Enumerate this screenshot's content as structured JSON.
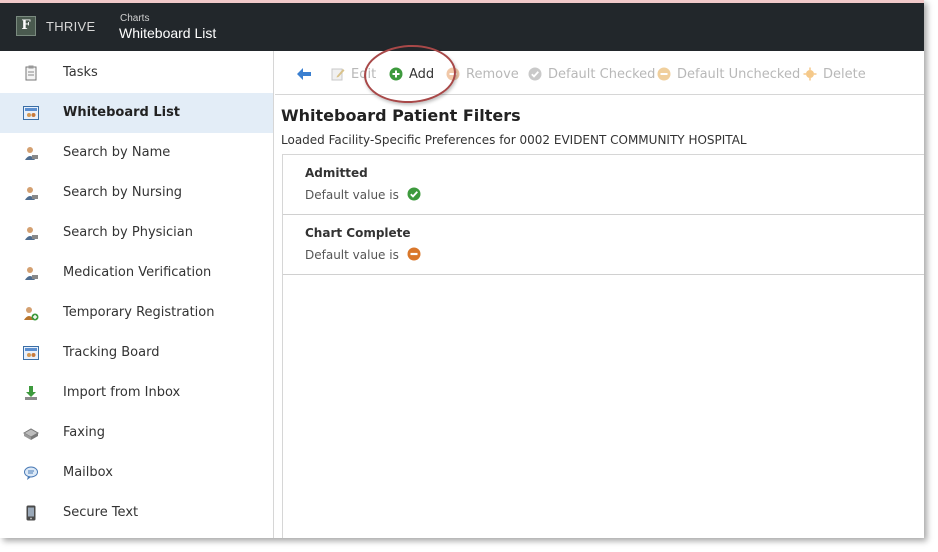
{
  "header": {
    "brand": "THRIVE",
    "section": "Charts",
    "title": "Whiteboard List"
  },
  "sidebar": {
    "items": [
      {
        "label": "Tasks",
        "icon": "clipboard-icon"
      },
      {
        "label": "Whiteboard List",
        "icon": "whiteboard-icon",
        "active": true
      },
      {
        "label": "Search by Name",
        "icon": "person-search-icon"
      },
      {
        "label": "Search by Nursing",
        "icon": "person-search-icon"
      },
      {
        "label": "Search by Physician",
        "icon": "person-search-icon"
      },
      {
        "label": "Medication Verification",
        "icon": "person-search-icon"
      },
      {
        "label": "Temporary Registration",
        "icon": "person-add-icon"
      },
      {
        "label": "Tracking Board",
        "icon": "whiteboard-icon"
      },
      {
        "label": "Import from Inbox",
        "icon": "import-icon"
      },
      {
        "label": "Faxing",
        "icon": "fax-icon"
      },
      {
        "label": "Mailbox",
        "icon": "mailbox-icon"
      },
      {
        "label": "Secure Text",
        "icon": "phone-icon"
      }
    ]
  },
  "toolbar": {
    "edit_label": "Edit",
    "add_label": "Add",
    "remove_label": "Remove",
    "default_checked_label": "Default Checked",
    "default_unchecked_label": "Default Unchecked",
    "delete_label": "Delete"
  },
  "main": {
    "title": "Whiteboard Patient Filters",
    "subtitle": "Loaded Facility-Specific Preferences for 0002 EVIDENT COMMUNITY HOSPITAL",
    "filters": [
      {
        "name": "Admitted",
        "default_text": "Default value is",
        "default_state": "checked"
      },
      {
        "name": "Chart Complete",
        "default_text": "Default value is",
        "default_state": "unchecked"
      }
    ]
  },
  "colors": {
    "header_bg": "#22272b",
    "active_nav_bg": "#e3edf7",
    "check_green": "#3d9a3d",
    "minus_orange": "#d9772b",
    "annotation_red": "#a84848"
  }
}
